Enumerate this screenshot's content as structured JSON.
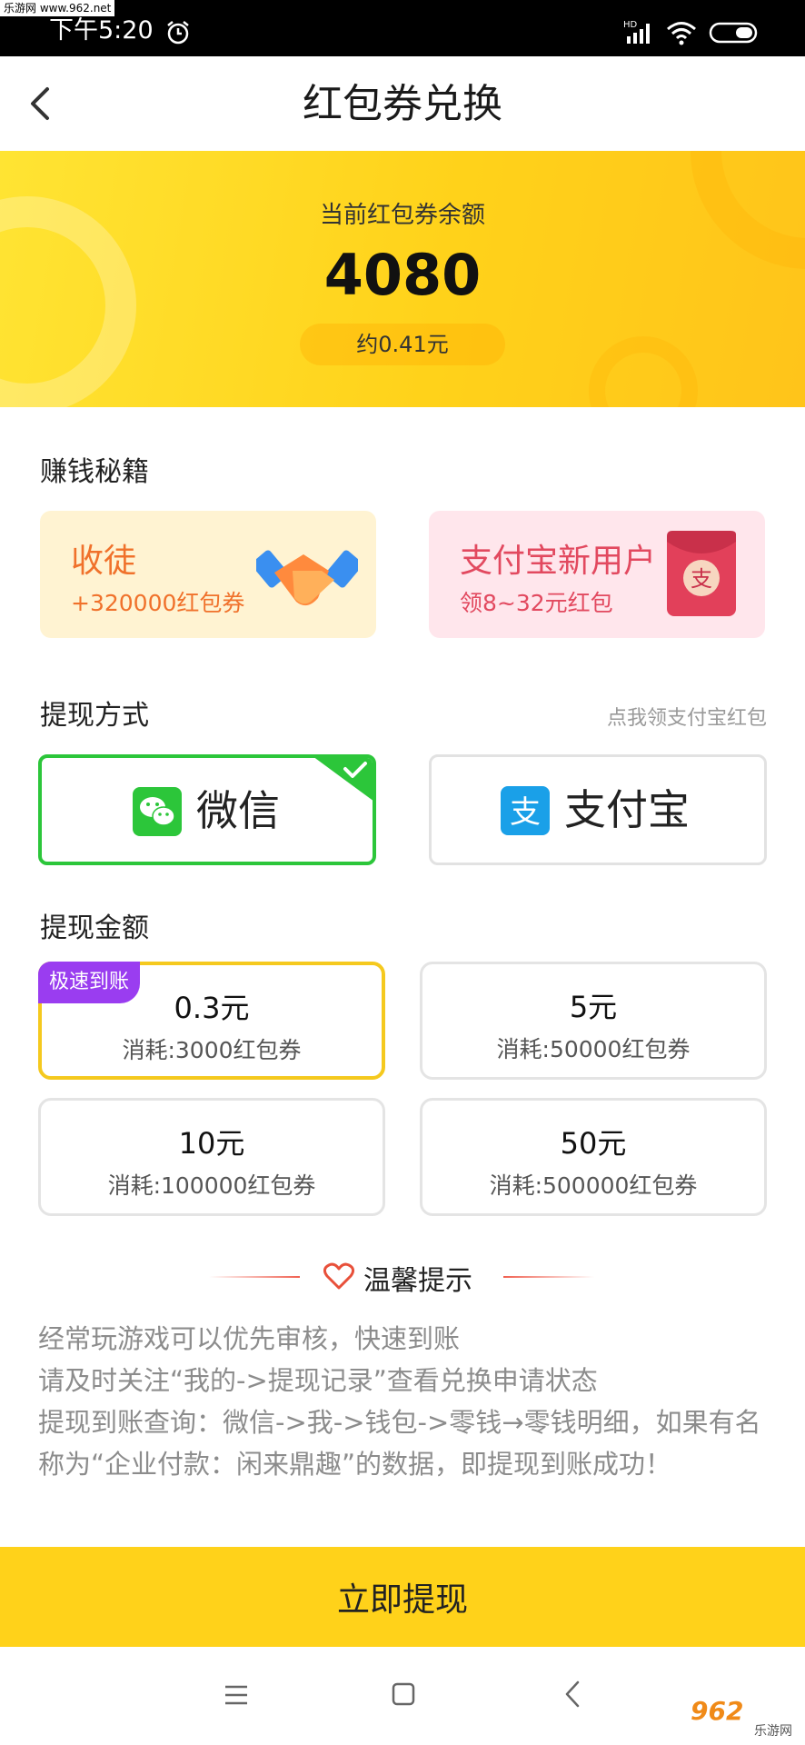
{
  "status_bar": {
    "watermark": "乐游网 www.962.net",
    "time": "下午5:20",
    "network": "HD"
  },
  "header": {
    "title": "红包券兑换"
  },
  "balance": {
    "label": "当前红包券余额",
    "value": "4080",
    "approx": "约0.41元"
  },
  "earn": {
    "title": "赚钱秘籍",
    "cards": [
      {
        "title": "收徒",
        "subtitle": "+320000红包券",
        "icon": "handshake-icon"
      },
      {
        "title": "支付宝新用户",
        "subtitle": "领8~32元红包",
        "icon": "red-packet-icon"
      }
    ]
  },
  "methods": {
    "title": "提现方式",
    "hint": "点我领支付宝红包",
    "selected": "wechat",
    "options": [
      {
        "label": "微信",
        "icon": "wechat-icon"
      },
      {
        "label": "支付宝",
        "icon": "alipay-icon"
      }
    ]
  },
  "amounts": {
    "title": "提现金额",
    "badge": "极速到账",
    "selected_index": 0,
    "options": [
      {
        "value": "0.3元",
        "cost": "消耗:3000红包券"
      },
      {
        "value": "5元",
        "cost": "消耗:50000红包券"
      },
      {
        "value": "10元",
        "cost": "消耗:100000红包券"
      },
      {
        "value": "50元",
        "cost": "消耗:500000红包券"
      }
    ]
  },
  "tips": {
    "title": "温馨提示",
    "lines": [
      "经常玩游戏可以优先审核，快速到账",
      "请及时关注“我的->提现记录”查看兑换申请状态",
      "提现到账查询：微信->我->钱包->零钱→零钱明细，如果有名称为“企业付款：闲来鼎趣”的数据，即提现到账成功！"
    ]
  },
  "action": {
    "withdraw_label": "立即提现"
  },
  "watermark_br": {
    "big": "962",
    "small": "乐游网"
  },
  "colors": {
    "accent_yellow": "#ffd21a",
    "wechat_green": "#2cc63a",
    "alipay_blue": "#1aa0e8",
    "badge_purple": "#9a3df0"
  }
}
